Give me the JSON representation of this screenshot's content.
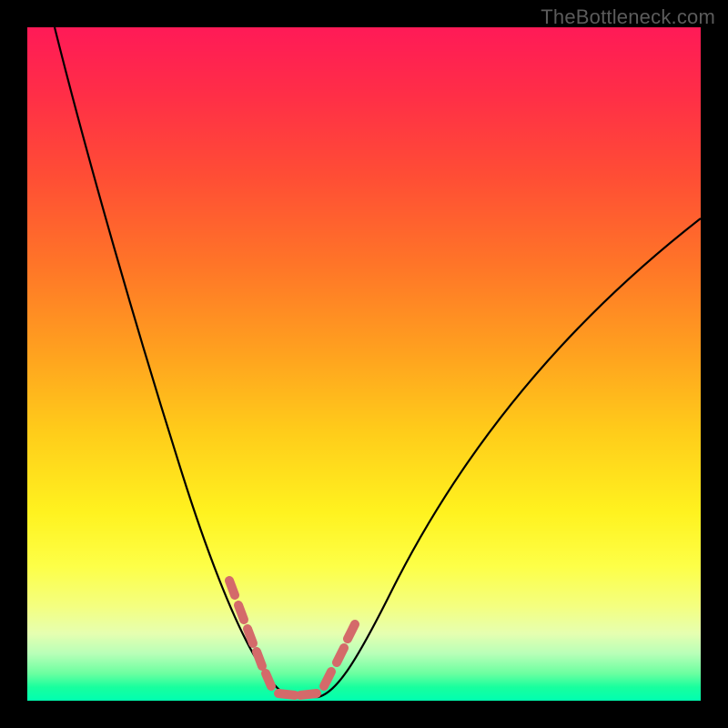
{
  "watermark": "TheBottleneck.com",
  "chart_data": {
    "type": "line",
    "title": "",
    "xlabel": "",
    "ylabel": "",
    "xlim": [
      0,
      100
    ],
    "ylim": [
      0,
      100
    ],
    "grid": false,
    "legend": false,
    "background_gradient": [
      "#ff1a57",
      "#ff4d35",
      "#ffcc1a",
      "#fdff47",
      "#18ff9e"
    ],
    "series": [
      {
        "name": "bottleneck-curve",
        "stroke": "#000000",
        "x": [
          4,
          8,
          12,
          16,
          20,
          24,
          28,
          30,
          32,
          34,
          36,
          38,
          40,
          42,
          46,
          50,
          55,
          60,
          65,
          70,
          75,
          80,
          85,
          90,
          95,
          100
        ],
        "y": [
          100,
          85,
          72,
          60,
          49,
          38,
          28,
          23,
          18,
          12,
          6,
          2,
          0,
          0,
          2,
          8,
          16,
          24,
          32,
          40,
          47,
          54,
          60,
          65,
          70,
          74
        ]
      },
      {
        "name": "highlight-markers",
        "stroke": "#d46a6a",
        "marker": "round",
        "x": [
          30,
          31.5,
          33,
          34.5,
          36,
          38,
          40,
          42,
          44,
          45.5,
          47
        ],
        "y": [
          20,
          17,
          13,
          9,
          5,
          2,
          0,
          0,
          2,
          5,
          9
        ]
      }
    ],
    "annotations": []
  }
}
